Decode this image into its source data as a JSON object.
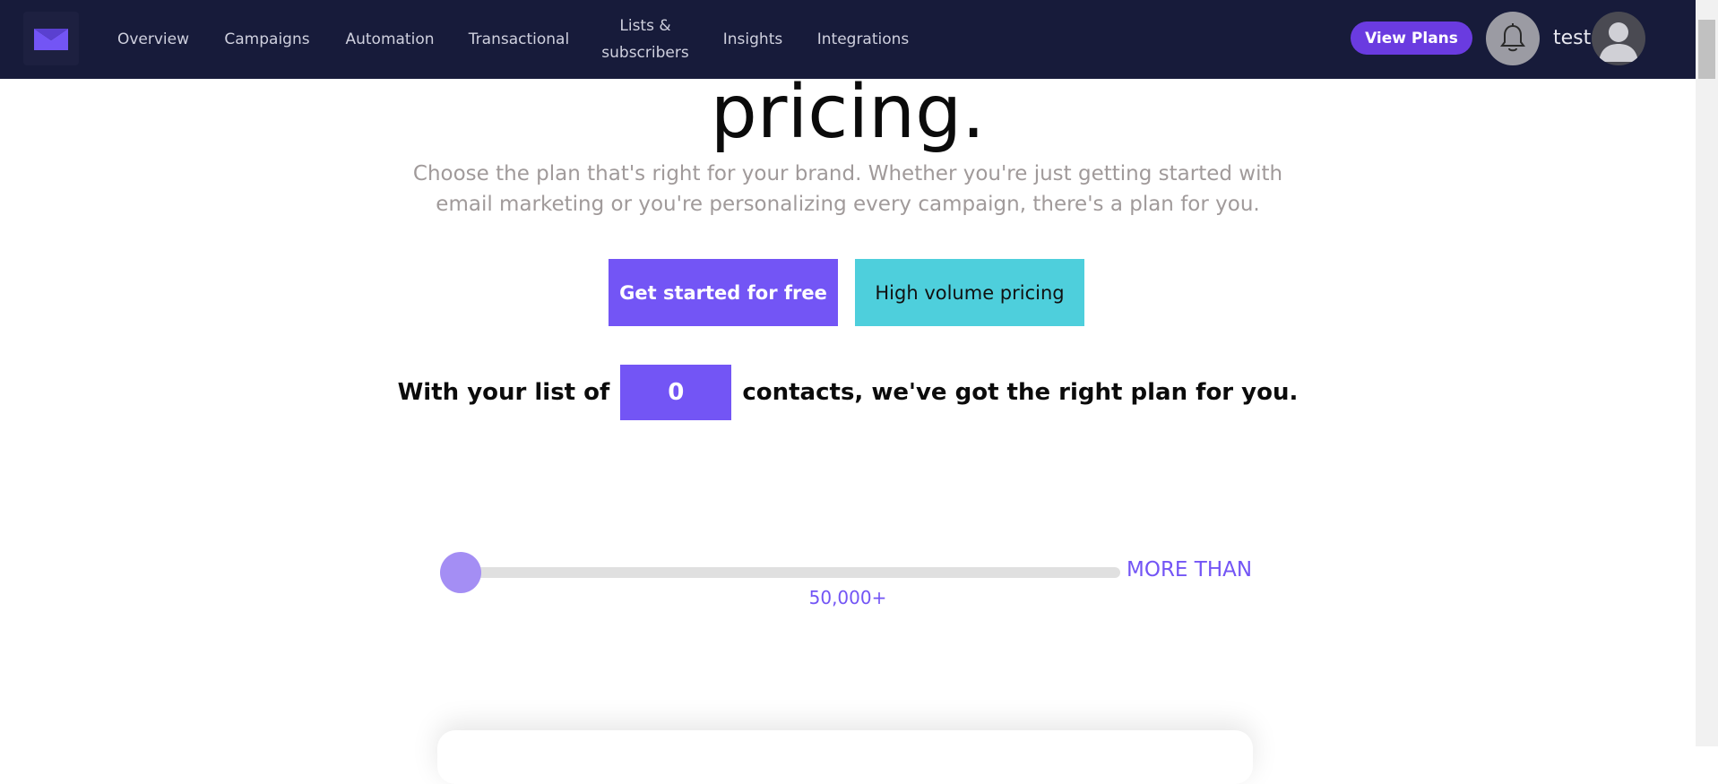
{
  "nav": {
    "items": [
      {
        "label": "Overview"
      },
      {
        "label": "Campaigns"
      },
      {
        "label": "Automation"
      },
      {
        "label": "Transactional"
      },
      {
        "label": "Lists &\nsubscribers"
      },
      {
        "label": "Insights"
      },
      {
        "label": "Integrations"
      }
    ],
    "view_plans_label": "View Plans",
    "username": "test"
  },
  "hero": {
    "title": "pricing.",
    "subtitle": "Choose the plan that's right for your brand. Whether you're just getting started with email marketing or you're personalizing every campaign, there's a plan for you."
  },
  "buttons": {
    "primary": "Get started for free",
    "secondary": "High volume pricing"
  },
  "contacts": {
    "prefix": "With your list of",
    "value": "0",
    "suffix": "contacts, we've got the right plan for you."
  },
  "slider": {
    "more_label": "MORE THAN",
    "max_label": "50,000+",
    "level": 0
  },
  "colors": {
    "nav_bg": "#171b3a",
    "accent": "#7355f5",
    "secondary_btn": "#4ecfdc"
  }
}
